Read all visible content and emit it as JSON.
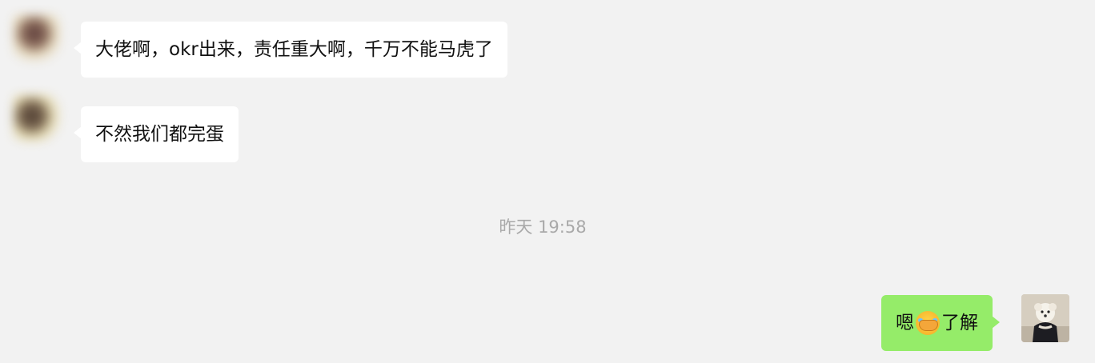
{
  "messages": [
    {
      "side": "left",
      "text": "大佬啊，okr出来，责任重大啊，千万不能马虎了"
    },
    {
      "side": "left",
      "text": "不然我们都完蛋"
    }
  ],
  "timestamp": "昨天 19:58",
  "reply": {
    "side": "right",
    "text_before": "嗯",
    "emoji": "facepalm-emoji",
    "text_after": "了解"
  },
  "colors": {
    "background": "#f2f2f2",
    "incoming_bubble": "#ffffff",
    "outgoing_bubble": "#95ec69",
    "timestamp_text": "#a9a9a9"
  }
}
